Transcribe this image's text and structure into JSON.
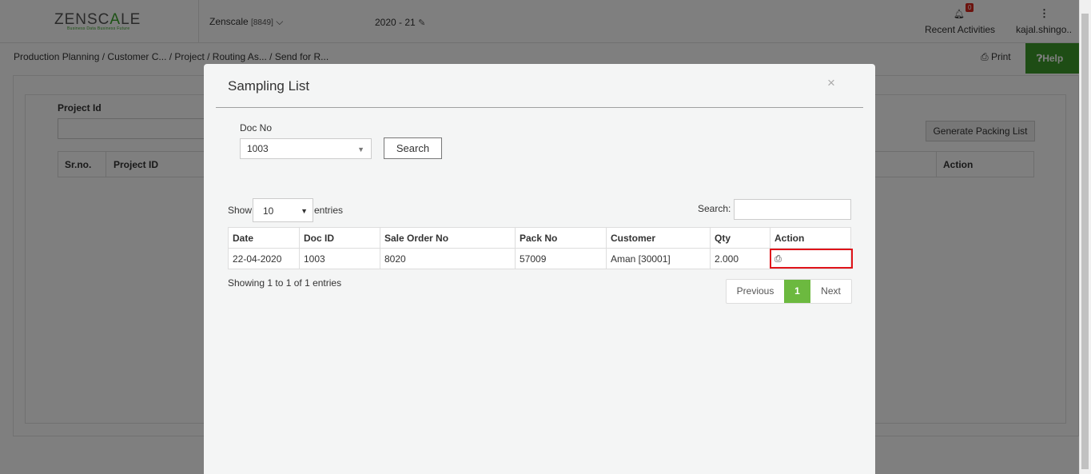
{
  "header": {
    "logo_main": "ZENSC",
    "logo_accent": "A",
    "logo_end": "LE",
    "logo_tagline": "Business Data Business Future",
    "company": "Zenscale",
    "company_code": "[8849]",
    "year": "2020 - 21",
    "notification_count": "0",
    "recent_activities": "Recent Activities",
    "user": "kajal.shingo.."
  },
  "breadcrumb": "Production Planning  / Customer C... / Project / Routing As... / Send for R...",
  "toolbar": {
    "print_label": "Print",
    "help_label": "Help"
  },
  "background": {
    "project_id_label": "Project Id",
    "generate_button": "Generate Packing List",
    "columns": [
      "Sr.no.",
      "Project ID",
      "Action"
    ]
  },
  "modal": {
    "title": "Sampling List",
    "close": "×",
    "doc_no_label": "Doc No",
    "doc_no_value": "1003",
    "search_button": "Search",
    "show_label": "Show",
    "show_value": "10",
    "entries_label": "entries",
    "search_label": "Search:",
    "table": {
      "headers": [
        "Date",
        "Doc ID",
        "Sale Order No",
        "Pack No",
        "Customer",
        "Qty",
        "Action"
      ],
      "rows": [
        [
          "22-04-2020",
          "1003",
          "8020",
          "57009",
          "Aman [30001]",
          "2.000"
        ]
      ]
    },
    "info": "Showing 1 to 1 of 1 entries",
    "pagination": {
      "previous": "Previous",
      "current": "1",
      "next": "Next"
    }
  }
}
